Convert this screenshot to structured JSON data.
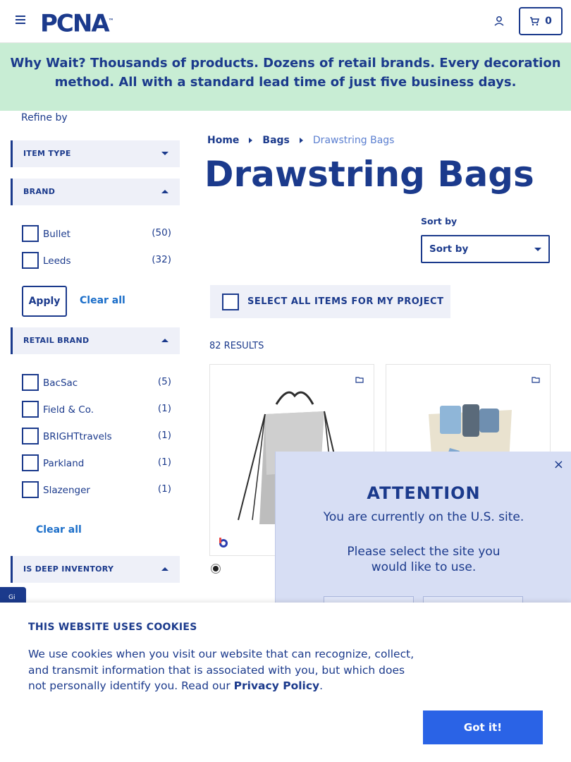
{
  "header": {
    "logo": "PCNA",
    "logo_mark": "™",
    "cart_count": "0",
    "icons": {
      "menu": "hamburger-icon",
      "account": "user-icon",
      "cart": "cart-icon"
    }
  },
  "banner": {
    "lead": "Why Wait?",
    "text": " Thousands of products. Dozens of retail brands. Every decoration method. All with a standard lead time of just five business days."
  },
  "sidebar": {
    "refine_label": "Refine by",
    "facets": {
      "item_type": "ITEM TYPE",
      "brand": "BRAND",
      "retail_brand": "RETAIL BRAND",
      "deep_inventory": "IS DEEP INVENTORY"
    },
    "brand_options": [
      {
        "label": "Bullet",
        "count": "(50)"
      },
      {
        "label": "Leeds",
        "count": "(32)"
      }
    ],
    "retail_brand_options": [
      {
        "label": "BacSac",
        "count": "(5)"
      },
      {
        "label": "Field & Co.",
        "count": "(1)"
      },
      {
        "label": "BRIGHTtravels",
        "count": "(1)"
      },
      {
        "label": "Parkland",
        "count": "(1)"
      },
      {
        "label": "Slazenger",
        "count": "(1)"
      }
    ],
    "apply_label": "Apply",
    "clear_all_label": "Clear all",
    "side_tab_text": "Gi"
  },
  "breadcrumb": [
    "Home",
    "Bags",
    "Drawstring Bags"
  ],
  "page_title": "Drawstring Bags",
  "sort": {
    "label": "Sort by",
    "selected": "Sort by"
  },
  "select_all_label": "SELECT ALL ITEMS FOR MY PROJECT",
  "results_label": "82 RESULTS",
  "attention": {
    "close": "×",
    "title": "ATTENTION",
    "line1": "You are currently on the U.S. site.",
    "line2": "Please select the site you",
    "line3": "would like to use."
  },
  "cookie": {
    "title": "THIS WEBSITE USES COOKIES",
    "text": "We use cookies when you visit our website that can recognize, collect, and transmit information that is associated with you, but which does not personally identify you. Read our ",
    "link": "Privacy Policy",
    "end": ".",
    "button": "Got it!"
  },
  "colors": {
    "brand_navy": "#1b3a8c",
    "banner_green": "#c8edd4",
    "cta_blue": "#2a63e6",
    "modal_bg": "#d7def4"
  }
}
